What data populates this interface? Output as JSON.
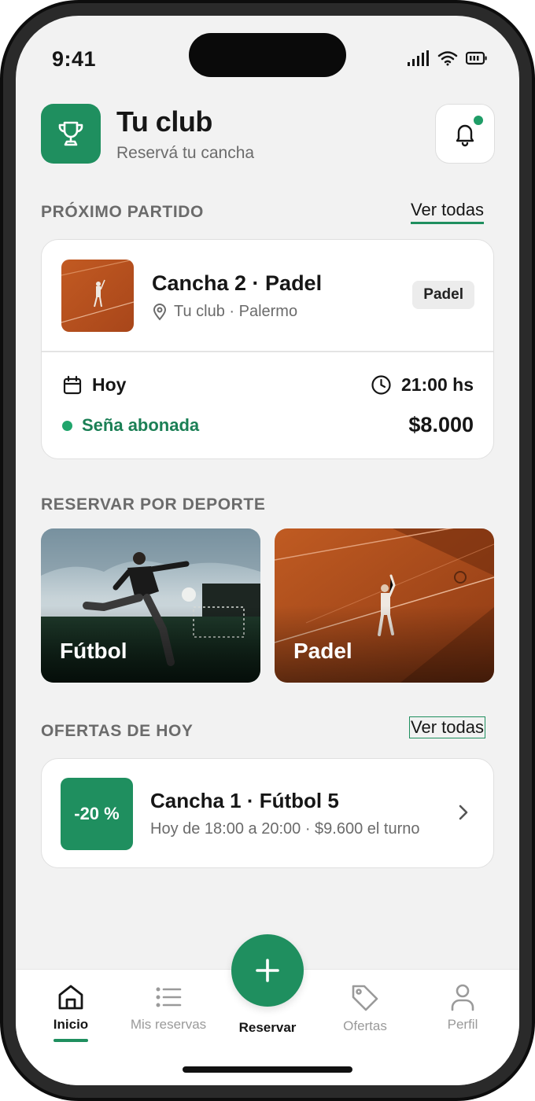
{
  "status_bar": {
    "time": "9:41"
  },
  "header": {
    "title": "Tu club",
    "subtitle": "Reservá tu cancha"
  },
  "next_match": {
    "section_title": "PRÓXIMO PARTIDO",
    "see_all": "Ver todas",
    "court": "Cancha 2 · Padel",
    "location": "Tu club · Palermo",
    "sport_badge": "Padel",
    "date": "Hoy",
    "time": "21:00 hs",
    "payment_status": "Seña abonada",
    "price": "$8.000"
  },
  "sports": {
    "section_title": "RESERVAR POR DEPORTE",
    "items": [
      {
        "label": "Fútbol"
      },
      {
        "label": "Padel"
      }
    ]
  },
  "offers": {
    "section_title": "OFERTAS DE HOY",
    "see_all": "Ver todas",
    "items": [
      {
        "discount": "-20 %",
        "title": "Cancha 1 · Fútbol 5",
        "detail": "Hoy de 18:00 a 20:00 · $9.600 el turno"
      }
    ]
  },
  "bottom_nav": {
    "items": [
      {
        "label": "Inicio",
        "icon": "home-icon",
        "active": true
      },
      {
        "label": "Mis reservas",
        "icon": "list-icon",
        "active": false
      },
      {
        "label": "Reservar",
        "icon": "plus-icon",
        "active": false
      },
      {
        "label": "Ofertas",
        "icon": "tag-icon",
        "active": false
      },
      {
        "label": "Perfil",
        "icon": "user-icon",
        "active": false
      }
    ]
  },
  "colors": {
    "accent": "#1f8f5f",
    "background": "#f2f2f2",
    "status_dot": "#20a56c"
  }
}
